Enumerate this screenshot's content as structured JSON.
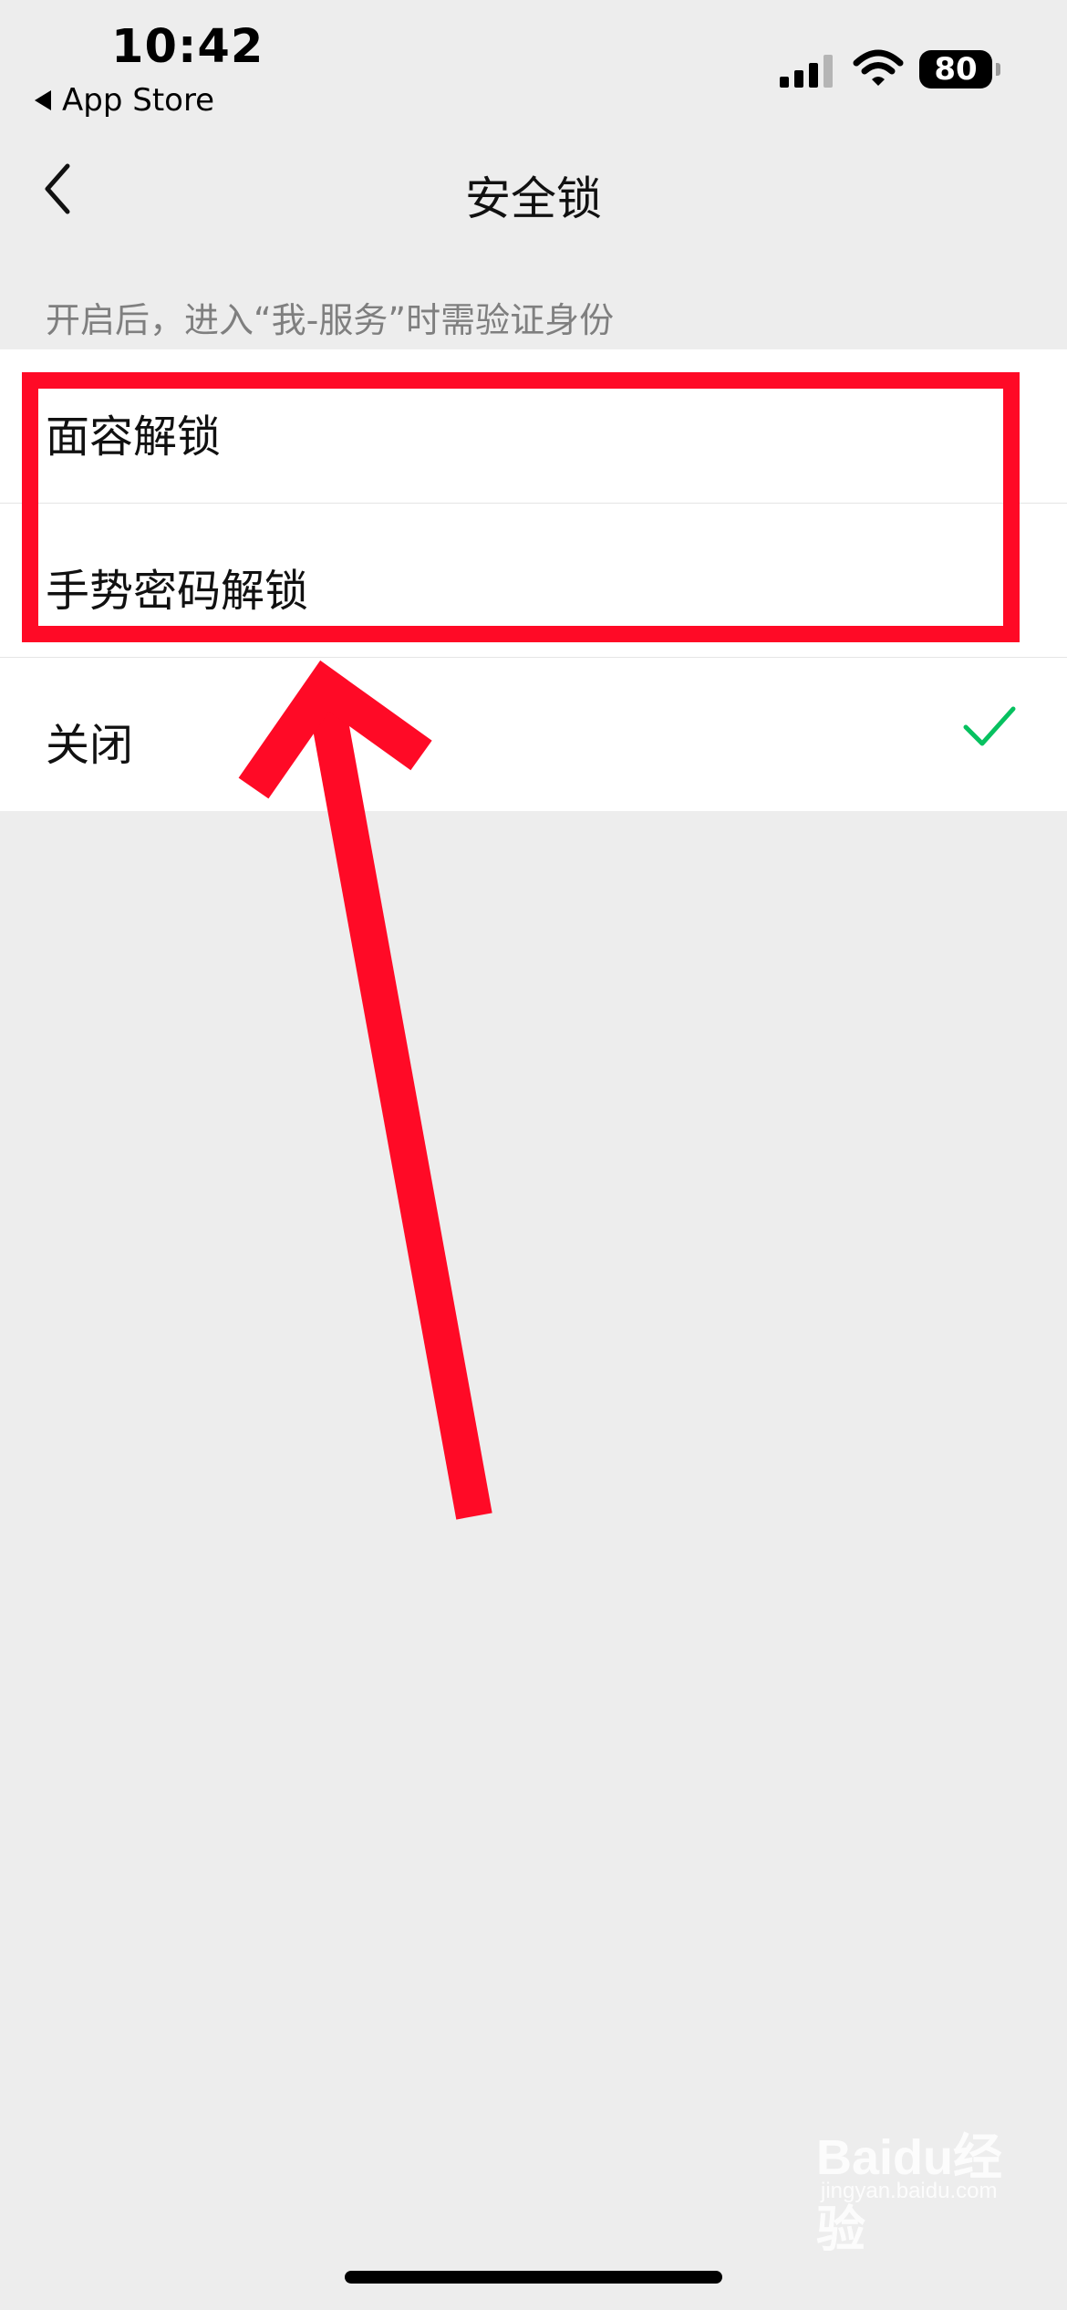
{
  "status_bar": {
    "time": "10:42",
    "back_app": "App Store",
    "battery": "80"
  },
  "nav": {
    "title": "安全锁"
  },
  "hint": "开启后，进入“我-服务”时需验证身份",
  "options": [
    {
      "label": "面容解锁",
      "selected": false
    },
    {
      "label": "手势密码解锁",
      "selected": false
    },
    {
      "label": "关闭",
      "selected": true
    }
  ],
  "accent_color": "#07c160",
  "annotation_color": "#ff0a26",
  "watermark": {
    "text": "Baidu经验",
    "sub": "jingyan.baidu.com"
  }
}
